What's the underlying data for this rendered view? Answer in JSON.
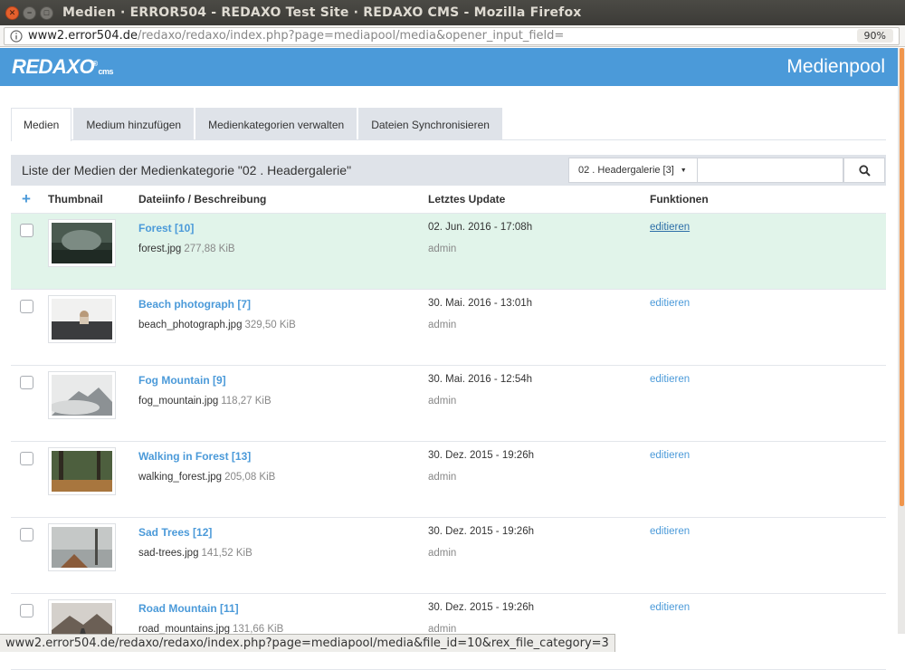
{
  "window": {
    "title": "Medien · ERROR504 - REDAXO Test Site · REDAXO CMS - Mozilla Firefox",
    "close_glyph": "✕",
    "min_glyph": "−",
    "max_glyph": "□"
  },
  "urlbar": {
    "host": "www2.error504.de",
    "path": "/redaxo/redaxo/index.php?page=mediapool/media&opener_input_field=",
    "zoom": "90%"
  },
  "header": {
    "logo": "REDAXO",
    "logo_suffix": "cms",
    "title": "Medienpool",
    "accent": "#4b9ad9"
  },
  "tabs": [
    {
      "label": "Medien",
      "active": true
    },
    {
      "label": "Medium hinzufügen",
      "active": false
    },
    {
      "label": "Medienkategorien verwalten",
      "active": false
    },
    {
      "label": "Dateien Synchronisieren",
      "active": false
    }
  ],
  "panel": {
    "title": "Liste der Medien der Medienkategorie \"02 . Headergalerie\"",
    "category_select": "02 . Headergalerie [3]",
    "search_value": ""
  },
  "table": {
    "headers": {
      "add": "+",
      "thumbnail": "Thumbnail",
      "info": "Dateiinfo / Beschreibung",
      "updated": "Letztes Update",
      "functions": "Funktionen"
    },
    "rows": [
      {
        "title": "Forest [10]",
        "file": "forest.jpg",
        "size": "277,88 KiB",
        "date": "02. Jun. 2016 - 17:08h",
        "user": "admin",
        "action": "editieren",
        "highlight": true,
        "thumb": "forest"
      },
      {
        "title": "Beach photograph [7]",
        "file": "beach_photograph.jpg",
        "size": "329,50 KiB",
        "date": "30. Mai. 2016 - 13:01h",
        "user": "admin",
        "action": "editieren",
        "highlight": false,
        "thumb": "beach"
      },
      {
        "title": "Fog Mountain [9]",
        "file": "fog_mountain.jpg",
        "size": "118,27 KiB",
        "date": "30. Mai. 2016 - 12:54h",
        "user": "admin",
        "action": "editieren",
        "highlight": false,
        "thumb": "fog"
      },
      {
        "title": "Walking in Forest [13]",
        "file": "walking_forest.jpg",
        "size": "205,08 KiB",
        "date": "30. Dez. 2015 - 19:26h",
        "user": "admin",
        "action": "editieren",
        "highlight": false,
        "thumb": "walking"
      },
      {
        "title": "Sad Trees [12]",
        "file": "sad-trees.jpg",
        "size": "141,52 KiB",
        "date": "30. Dez. 2015 - 19:26h",
        "user": "admin",
        "action": "editieren",
        "highlight": false,
        "thumb": "sad"
      },
      {
        "title": "Road Mountain [11]",
        "file": "road_mountains.jpg",
        "size": "131,66 KiB",
        "date": "30. Dez. 2015 - 19:26h",
        "user": "admin",
        "action": "editieren",
        "highlight": false,
        "thumb": "road"
      }
    ]
  },
  "statusbar": {
    "text": "www2.error504.de/redaxo/redaxo/index.php?page=mediapool/media&file_id=10&rex_file_category=3"
  }
}
